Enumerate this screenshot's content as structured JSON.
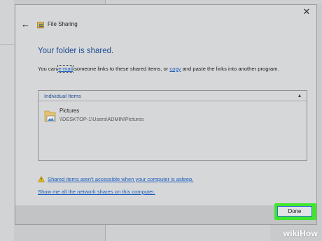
{
  "dialog": {
    "title": "File Sharing",
    "close_symbol": "✕",
    "back_symbol": "←",
    "heading": "Your folder is shared.",
    "desc": {
      "part1": "You can ",
      "email_link": "e-mail",
      "part2": " someone links to these shared items, or ",
      "copy_link": "copy",
      "part3": " and paste the links into another program."
    },
    "items": {
      "header": "Individual Items",
      "collapse_symbol": "▴",
      "rows": [
        {
          "name": "Pictures",
          "path": "\\\\DESKTOP-1\\Users\\ADMIN\\Pictures"
        }
      ]
    },
    "warning_link": "Shared items aren't accessible when your computer is asleep.",
    "shares_link": "Show me all the network shares on this computer.",
    "done_label": "Done"
  },
  "watermark": {
    "wiki": "wiki",
    "how": "How"
  },
  "colors": {
    "accent": "#1f4e96",
    "link": "#1a5dbf",
    "highlight": "#41e52e"
  }
}
